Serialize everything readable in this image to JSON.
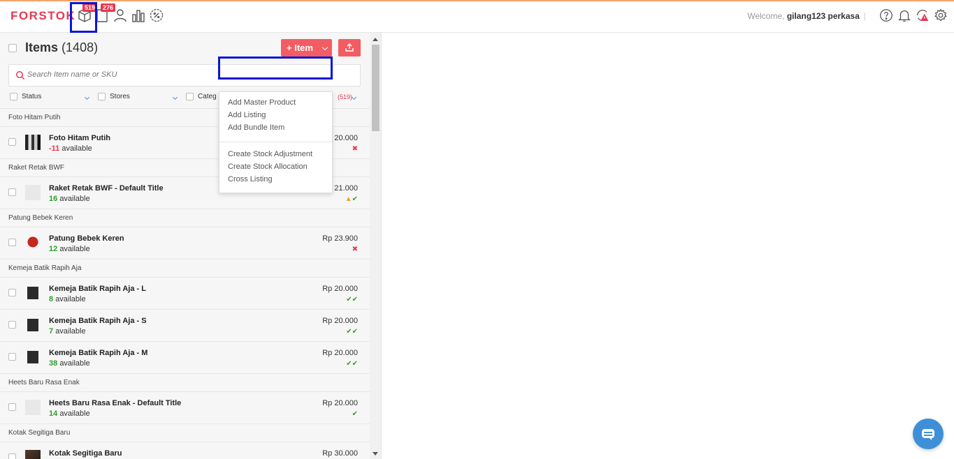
{
  "header": {
    "logo": "FORSTOK",
    "nav": [
      {
        "icon": "box-icon",
        "badge": "519"
      },
      {
        "icon": "document-icon",
        "badge": "276"
      },
      {
        "icon": "user-icon"
      },
      {
        "icon": "chart-icon"
      },
      {
        "icon": "discount-icon"
      }
    ],
    "welcome_prefix": "Welcome,",
    "username": "gilang123 perkasa",
    "separator": "|",
    "right_icons": [
      "help-icon",
      "bell-icon",
      "sync-alert-icon",
      "gear-icon"
    ]
  },
  "items_panel": {
    "title": "Items",
    "count": "(1408)",
    "add_button": "+ Item",
    "search_placeholder": "Search Item name or SKU",
    "filters": [
      "Status",
      "Stores",
      "Categ"
    ],
    "filter_count": "(519)"
  },
  "dropdown": {
    "items": [
      "Add Master Product",
      "Add Listing",
      "Add Bundle Item",
      "Create Stock Adjustment",
      "Create Stock Allocation",
      "Cross Listing"
    ]
  },
  "list": [
    {
      "group": "Foto Hitam Putih",
      "rows": [
        {
          "name": "Foto Hitam Putih",
          "qty": "-11",
          "avail": "available",
          "price": "20.000",
          "status": "✖"
        }
      ]
    },
    {
      "group": "Raket Retak BWF",
      "rows": [
        {
          "name": "Raket Retak BWF - Default Title",
          "qty": "16",
          "avail": "available",
          "price": "Rp 21.000",
          "status": "▲✔"
        }
      ]
    },
    {
      "group": "Patung Bebek Keren",
      "rows": [
        {
          "name": "Patung Bebek Keren",
          "qty": "12",
          "avail": "available",
          "price": "Rp 23.900",
          "status": "✖"
        }
      ]
    },
    {
      "group": "Kemeja Batik Rapih Aja",
      "rows": [
        {
          "name": "Kemeja Batik Rapih Aja - L",
          "qty": "8",
          "avail": "available",
          "price": "Rp 20.000",
          "status": "✔✔"
        },
        {
          "name": "Kemeja Batik Rapih Aja - S",
          "qty": "7",
          "avail": "available",
          "price": "Rp 20.000",
          "status": "✔✔"
        },
        {
          "name": "Kemeja Batik Rapih Aja - M",
          "qty": "38",
          "avail": "available",
          "price": "Rp 20.000",
          "status": "✔✔"
        }
      ]
    },
    {
      "group": "Heets Baru Rasa Enak",
      "rows": [
        {
          "name": "Heets Baru Rasa Enak - Default Title",
          "qty": "14",
          "avail": "available",
          "price": "Rp 20.000",
          "status": "✔"
        }
      ]
    },
    {
      "group": "Kotak Segitiga Baru",
      "rows": [
        {
          "name": "Kotak Segitiga Baru",
          "qty": "",
          "avail": "",
          "price": "Rp 30.000",
          "status": ""
        }
      ]
    }
  ],
  "colors": {
    "brand": "#e8384f",
    "button": "#f25d63",
    "ok": "#2e9e2e",
    "highlight": "#0a16d8"
  }
}
